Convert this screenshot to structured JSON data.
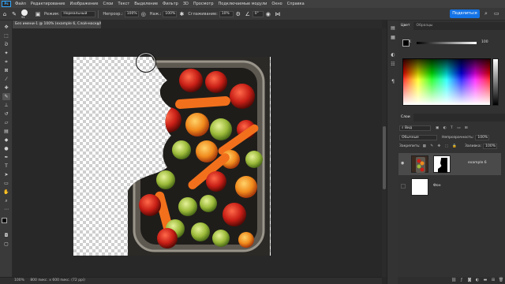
{
  "app": {
    "logo": "Ps"
  },
  "menu": [
    "Файл",
    "Редактирование",
    "Изображение",
    "Слои",
    "Текст",
    "Выделение",
    "Фильтр",
    "3D",
    "Просмотр",
    "Подключаемые модули",
    "Окно",
    "Справка"
  ],
  "options": {
    "brush_size": "94",
    "mode_label": "Режим:",
    "mode_value": "Нормальный",
    "opacity_label": "Непрозр.:",
    "opacity_value": "100%",
    "flow_label": "Наж.:",
    "flow_value": "100%",
    "smoothing_label": "Сглаживание:",
    "smoothing_value": "10%",
    "angle_value": "0°",
    "share_label": "Поделиться"
  },
  "document": {
    "tab_title": "Без имени-1 @ 100% (example 6, Слой-маска/8) *",
    "close": "×"
  },
  "status": {
    "zoom": "100%",
    "info": "800 пикс. x 600 пикс. (72 ppi)"
  },
  "panels": {
    "color_tab": "Цвет",
    "swatches_tab": "Образцы",
    "color_channel": "K",
    "color_value": "100",
    "layers_tab": "Слои",
    "kind_label": "Вид",
    "blend_value": "Обычные",
    "opacity_label": "Непрозрачность:",
    "opacity_value": "100%",
    "lock_label": "Закрепить:",
    "fill_label": "Заливка:",
    "fill_value": "100%",
    "layers": [
      {
        "name": "example 6"
      },
      {
        "name": "Фон"
      }
    ]
  },
  "colors": {
    "accent": "#1473e6",
    "bg": "#282828",
    "panel": "#323232"
  }
}
